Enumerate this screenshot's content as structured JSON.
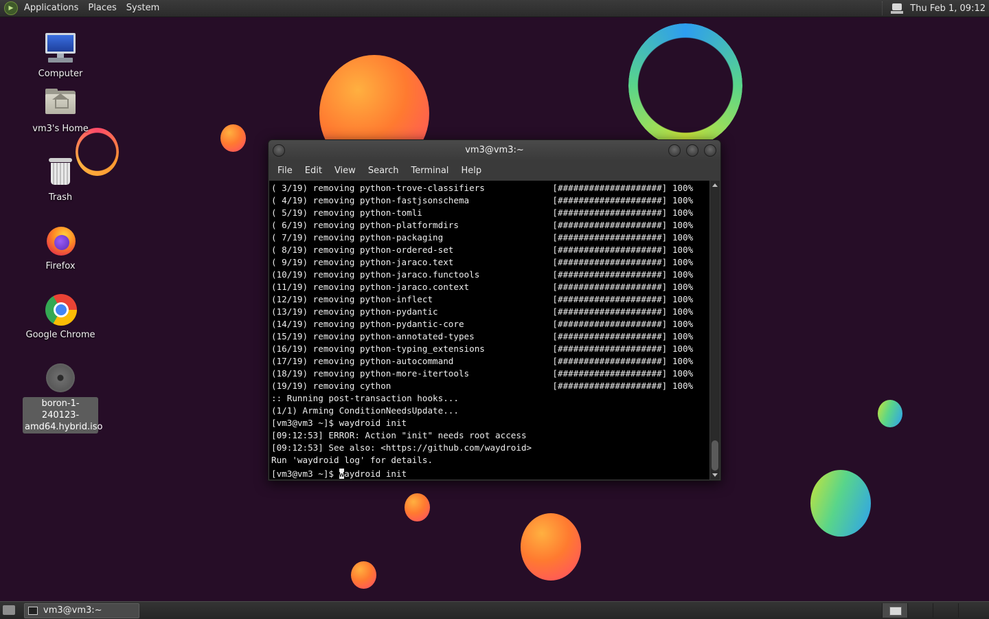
{
  "top_panel": {
    "menus": [
      "Applications",
      "Places",
      "System"
    ],
    "clock": "Thu Feb  1, 09:12"
  },
  "desktop_icons": [
    {
      "label": "Computer",
      "icon": "computer-icon"
    },
    {
      "label": "vm3's Home",
      "icon": "home-folder-icon"
    },
    {
      "label": "Trash",
      "icon": "trash-icon"
    },
    {
      "label": "Firefox",
      "icon": "firefox-icon"
    },
    {
      "label": "Google Chrome",
      "icon": "chrome-icon"
    },
    {
      "label": "boron-1-240123-amd64.hybrid.iso",
      "icon": "disc-image-icon",
      "selected": true
    }
  ],
  "terminal": {
    "title": "vm3@vm3:~",
    "menus": [
      "File",
      "Edit",
      "View",
      "Search",
      "Terminal",
      "Help"
    ],
    "lines": [
      "( 3/19) removing python-trove-classifiers             [####################] 100%",
      "( 4/19) removing python-fastjsonschema                [####################] 100%",
      "( 5/19) removing python-tomli                         [####################] 100%",
      "( 6/19) removing python-platformdirs                  [####################] 100%",
      "( 7/19) removing python-packaging                     [####################] 100%",
      "( 8/19) removing python-ordered-set                   [####################] 100%",
      "( 9/19) removing python-jaraco.text                   [####################] 100%",
      "(10/19) removing python-jaraco.functools              [####################] 100%",
      "(11/19) removing python-jaraco.context                [####################] 100%",
      "(12/19) removing python-inflect                       [####################] 100%",
      "(13/19) removing python-pydantic                      [####################] 100%",
      "(14/19) removing python-pydantic-core                 [####################] 100%",
      "(15/19) removing python-annotated-types               [####################] 100%",
      "(16/19) removing python-typing_extensions             [####################] 100%",
      "(17/19) removing python-autocommand                   [####################] 100%",
      "(18/19) removing python-more-itertools                [####################] 100%",
      "(19/19) removing cython                               [####################] 100%",
      ":: Running post-transaction hooks...",
      "(1/1) Arming ConditionNeedsUpdate...",
      "[vm3@vm3 ~]$ waydroid init",
      "[09:12:53] ERROR: Action \"init\" needs root access",
      "[09:12:53] See also: <https://github.com/waydroid>",
      "Run 'waydroid log' for details."
    ],
    "prompt": "[vm3@vm3 ~]$ ",
    "input_cursor_char": "w",
    "input_rest": "aydroid init"
  },
  "taskbar": {
    "task_label": "vm3@vm3:~"
  }
}
